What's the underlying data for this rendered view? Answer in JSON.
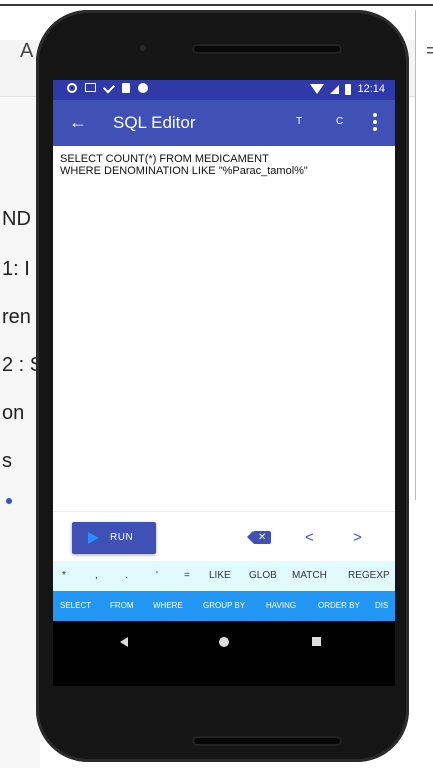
{
  "background": {
    "left_fragments": [
      "ND",
      "1: I",
      "ren",
      "2 : S",
      "on",
      "s"
    ],
    "top_left_letter": "A",
    "right_letter": "="
  },
  "status_bar": {
    "time": "12:14"
  },
  "app_bar": {
    "title": "SQL Editor",
    "button_t": "T",
    "button_c": "C"
  },
  "editor": {
    "lines": [
      "SELECT COUNT(*) FROM MEDICAMENT",
      "WHERE DENOMINATION LIKE \"%Parac_tamol%\""
    ]
  },
  "actions": {
    "run_label": "RUN",
    "prev": "<",
    "next": ">"
  },
  "symbol_bar": [
    "*",
    ",",
    ".",
    "'",
    "=",
    "LIKE",
    "GLOB",
    "MATCH",
    "REGEXP"
  ],
  "keyword_bar": [
    "SELECT",
    "FROM",
    "WHERE",
    "GROUP BY",
    "HAVING",
    "ORDER BY",
    "DIS"
  ],
  "colors": {
    "primary": "#3f51b5",
    "status_bar": "#3039a8",
    "symbol_bar_bg": "#e0faff",
    "keyword_bar_bg": "#2196f3",
    "run_icon": "#2a8cff"
  },
  "icons": {
    "back": "arrow-left-icon",
    "overflow": "more-vert-icon",
    "run": "play-icon",
    "backspace": "backspace-icon"
  }
}
